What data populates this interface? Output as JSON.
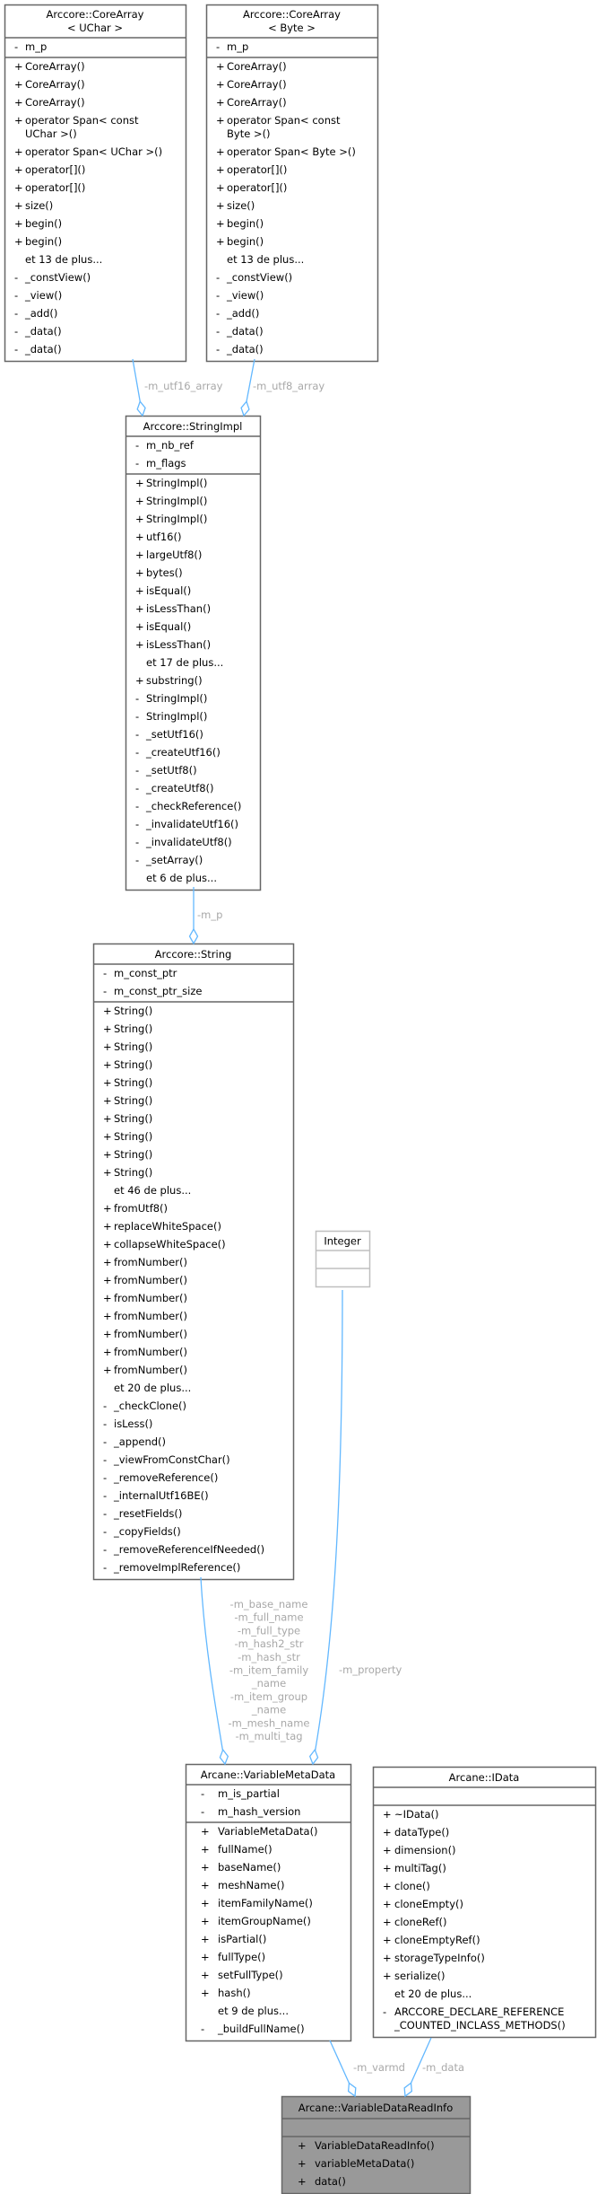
{
  "colors": {
    "edge": "#63b8ff",
    "label": "#a8a8a8",
    "border": "#666666",
    "border_light": "#bfbfbf",
    "focus_fill": "#999999"
  },
  "classes": [
    {
      "id": "ua",
      "title": [
        "Arccore::CoreArray",
        "< UChar >"
      ],
      "attributes": [
        {
          "vis": "-",
          "name": "m_p"
        }
      ],
      "methods": [
        {
          "vis": "+",
          "name": "CoreArray()"
        },
        {
          "vis": "+",
          "name": "CoreArray()"
        },
        {
          "vis": "+",
          "name": "CoreArray()"
        },
        {
          "vis": "+",
          "name": "operator Span< const",
          "cont": " UChar >()"
        },
        {
          "vis": "+",
          "name": "operator Span< UChar >()"
        },
        {
          "vis": "+",
          "name": "operator[]()"
        },
        {
          "vis": "+",
          "name": "operator[]()"
        },
        {
          "vis": "+",
          "name": "size()"
        },
        {
          "vis": "+",
          "name": "begin()"
        },
        {
          "vis": "+",
          "name": "begin()"
        },
        {
          "vis": "",
          "name": "et 13 de plus..."
        },
        {
          "vis": "-",
          "name": "_constView()"
        },
        {
          "vis": "-",
          "name": "_view()"
        },
        {
          "vis": "-",
          "name": "_add()"
        },
        {
          "vis": "-",
          "name": "_data()"
        },
        {
          "vis": "-",
          "name": "_data()"
        }
      ]
    },
    {
      "id": "ba",
      "title": [
        "Arccore::CoreArray",
        "< Byte >"
      ],
      "attributes": [
        {
          "vis": "-",
          "name": "m_p"
        }
      ],
      "methods": [
        {
          "vis": "+",
          "name": "CoreArray()"
        },
        {
          "vis": "+",
          "name": "CoreArray()"
        },
        {
          "vis": "+",
          "name": "CoreArray()"
        },
        {
          "vis": "+",
          "name": "operator Span< const",
          "cont": " Byte >()"
        },
        {
          "vis": "+",
          "name": "operator Span< Byte >()"
        },
        {
          "vis": "+",
          "name": "operator[]()"
        },
        {
          "vis": "+",
          "name": "operator[]()"
        },
        {
          "vis": "+",
          "name": "size()"
        },
        {
          "vis": "+",
          "name": "begin()"
        },
        {
          "vis": "+",
          "name": "begin()"
        },
        {
          "vis": "",
          "name": "et 13 de plus..."
        },
        {
          "vis": "-",
          "name": "_constView()"
        },
        {
          "vis": "-",
          "name": "_view()"
        },
        {
          "vis": "-",
          "name": "_add()"
        },
        {
          "vis": "-",
          "name": "_data()"
        },
        {
          "vis": "-",
          "name": "_data()"
        }
      ]
    },
    {
      "id": "si",
      "title": [
        "Arccore::StringImpl"
      ],
      "attributes": [
        {
          "vis": "-",
          "name": "m_nb_ref"
        },
        {
          "vis": "-",
          "name": "m_flags"
        }
      ],
      "methods": [
        {
          "vis": "+",
          "name": "StringImpl()"
        },
        {
          "vis": "+",
          "name": "StringImpl()"
        },
        {
          "vis": "+",
          "name": "StringImpl()"
        },
        {
          "vis": "+",
          "name": "utf16()"
        },
        {
          "vis": "+",
          "name": "largeUtf8()"
        },
        {
          "vis": "+",
          "name": "bytes()"
        },
        {
          "vis": "+",
          "name": "isEqual()"
        },
        {
          "vis": "+",
          "name": "isLessThan()"
        },
        {
          "vis": "+",
          "name": "isEqual()"
        },
        {
          "vis": "+",
          "name": "isLessThan()"
        },
        {
          "vis": "",
          "name": "et 17 de plus..."
        },
        {
          "vis": "+",
          "name": "substring()"
        },
        {
          "vis": "-",
          "name": "StringImpl()"
        },
        {
          "vis": "-",
          "name": "StringImpl()"
        },
        {
          "vis": "-",
          "name": "_setUtf16()"
        },
        {
          "vis": "-",
          "name": "_createUtf16()"
        },
        {
          "vis": "-",
          "name": "_setUtf8()"
        },
        {
          "vis": "-",
          "name": "_createUtf8()"
        },
        {
          "vis": "-",
          "name": "_checkReference()"
        },
        {
          "vis": "-",
          "name": "_invalidateUtf16()"
        },
        {
          "vis": "-",
          "name": "_invalidateUtf8()"
        },
        {
          "vis": "-",
          "name": "_setArray()"
        },
        {
          "vis": "",
          "name": "et 6 de plus..."
        }
      ]
    },
    {
      "id": "st",
      "title": [
        "Arccore::String"
      ],
      "attributes": [
        {
          "vis": "-",
          "name": "m_const_ptr"
        },
        {
          "vis": "-",
          "name": "m_const_ptr_size"
        }
      ],
      "methods": [
        {
          "vis": "+",
          "name": "String()"
        },
        {
          "vis": "+",
          "name": "String()"
        },
        {
          "vis": "+",
          "name": "String()"
        },
        {
          "vis": "+",
          "name": "String()"
        },
        {
          "vis": "+",
          "name": "String()"
        },
        {
          "vis": "+",
          "name": "String()"
        },
        {
          "vis": "+",
          "name": "String()"
        },
        {
          "vis": "+",
          "name": "String()"
        },
        {
          "vis": "+",
          "name": "String()"
        },
        {
          "vis": "+",
          "name": "String()"
        },
        {
          "vis": "",
          "name": "et 46 de plus..."
        },
        {
          "vis": "+",
          "name": "fromUtf8()"
        },
        {
          "vis": "+",
          "name": "replaceWhiteSpace()"
        },
        {
          "vis": "+",
          "name": "collapseWhiteSpace()"
        },
        {
          "vis": "+",
          "name": "fromNumber()"
        },
        {
          "vis": "+",
          "name": "fromNumber()"
        },
        {
          "vis": "+",
          "name": "fromNumber()"
        },
        {
          "vis": "+",
          "name": "fromNumber()"
        },
        {
          "vis": "+",
          "name": "fromNumber()"
        },
        {
          "vis": "+",
          "name": "fromNumber()"
        },
        {
          "vis": "+",
          "name": "fromNumber()"
        },
        {
          "vis": "",
          "name": "et 20 de plus..."
        },
        {
          "vis": "-",
          "name": "_checkClone()"
        },
        {
          "vis": "-",
          "name": "isLess()"
        },
        {
          "vis": "-",
          "name": "_append()"
        },
        {
          "vis": "-",
          "name": "_viewFromConstChar()"
        },
        {
          "vis": "-",
          "name": "_removeReference()"
        },
        {
          "vis": "-",
          "name": "_internalUtf16BE()"
        },
        {
          "vis": "-",
          "name": "_resetFields()"
        },
        {
          "vis": "-",
          "name": "_copyFields()"
        },
        {
          "vis": "-",
          "name": "_removeReferenceIfNeeded()"
        },
        {
          "vis": "-",
          "name": "_removeImplReference()"
        }
      ]
    },
    {
      "id": "int",
      "title": [
        "Integer"
      ],
      "attributes": [],
      "methods": []
    },
    {
      "id": "vmd",
      "title": [
        "Arcane::VariableMetaData"
      ],
      "attributes": [
        {
          "vis": "-",
          "name": "m_is_partial"
        },
        {
          "vis": "-",
          "name": "m_hash_version"
        }
      ],
      "methods": [
        {
          "vis": "+",
          "name": "VariableMetaData()"
        },
        {
          "vis": "+",
          "name": "fullName()"
        },
        {
          "vis": "+",
          "name": "baseName()"
        },
        {
          "vis": "+",
          "name": "meshName()"
        },
        {
          "vis": "+",
          "name": "itemFamilyName()"
        },
        {
          "vis": "+",
          "name": "itemGroupName()"
        },
        {
          "vis": "+",
          "name": "isPartial()"
        },
        {
          "vis": "+",
          "name": "fullType()"
        },
        {
          "vis": "+",
          "name": "setFullType()"
        },
        {
          "vis": "+",
          "name": "hash()"
        },
        {
          "vis": "",
          "name": "et 9 de plus..."
        },
        {
          "vis": "-",
          "name": "_buildFullName()"
        }
      ]
    },
    {
      "id": "id",
      "title": [
        "Arcane::IData"
      ],
      "attributes": [],
      "methods": [
        {
          "vis": "+",
          "name": "~IData()"
        },
        {
          "vis": "+",
          "name": "dataType()"
        },
        {
          "vis": "+",
          "name": "dimension()"
        },
        {
          "vis": "+",
          "name": "multiTag()"
        },
        {
          "vis": "+",
          "name": "clone()"
        },
        {
          "vis": "+",
          "name": "cloneEmpty()"
        },
        {
          "vis": "+",
          "name": "cloneRef()"
        },
        {
          "vis": "+",
          "name": "cloneEmptyRef()"
        },
        {
          "vis": "+",
          "name": "storageTypeInfo()"
        },
        {
          "vis": "+",
          "name": "serialize()"
        },
        {
          "vis": "",
          "name": "et 20 de plus..."
        },
        {
          "vis": "-",
          "name": "ARCCORE_DECLARE_REFERENCE",
          "cont": "_COUNTED_INCLASS_METHODS()"
        }
      ]
    },
    {
      "id": "vdri",
      "title": [
        "Arcane::VariableDataReadInfo"
      ],
      "attributes": [],
      "methods": [
        {
          "vis": "+",
          "name": "VariableDataReadInfo()"
        },
        {
          "vis": "+",
          "name": "variableMetaData()"
        },
        {
          "vis": "+",
          "name": "data()"
        }
      ]
    }
  ],
  "edges": [
    {
      "from": "ua",
      "to": "si",
      "label": [
        "-m_utf16_array"
      ]
    },
    {
      "from": "ba",
      "to": "si",
      "label": [
        "-m_utf8_array"
      ]
    },
    {
      "from": "si",
      "to": "st",
      "label": [
        "-m_p"
      ]
    },
    {
      "from": "st",
      "to": "vmd",
      "label": [
        "-m_base_name",
        "-m_full_name",
        "-m_full_type",
        "-m_hash2_str",
        "-m_hash_str",
        "-m_item_family",
        "_name",
        "-m_item_group",
        "_name",
        "-m_mesh_name",
        "-m_multi_tag"
      ]
    },
    {
      "from": "int",
      "to": "vmd",
      "label": [
        "-m_property"
      ]
    },
    {
      "from": "vmd",
      "to": "vdri",
      "label": [
        "-m_varmd"
      ]
    },
    {
      "from": "id",
      "to": "vdri",
      "label": [
        "-m_data"
      ]
    }
  ]
}
